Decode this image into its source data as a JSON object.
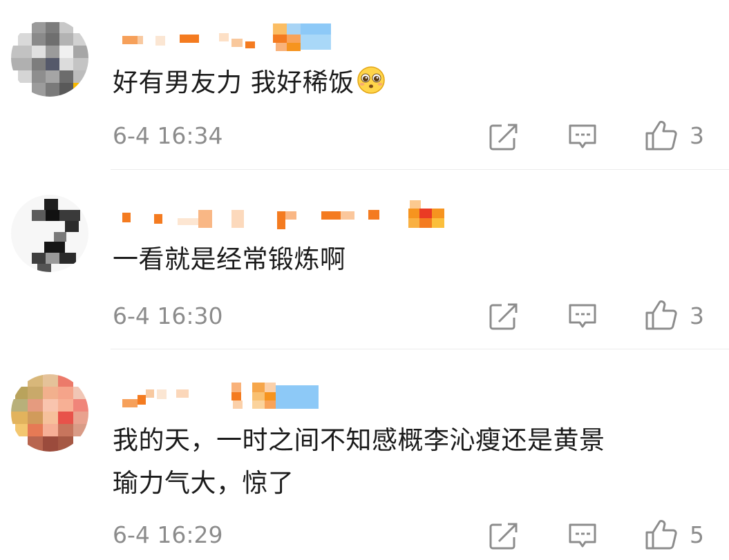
{
  "comments": [
    {
      "text": "好有男友力 我好稀饭",
      "emoji": "pleading-face-emoji",
      "time": "6-4 16:34",
      "likes": "3"
    },
    {
      "text": "一看就是经常锻炼啊",
      "time": "6-4 16:30",
      "likes": "3"
    },
    {
      "text_line1": "我的天，一时之间不知感概李沁瘦还是黄景",
      "text_line2": "瑜力气大，惊了",
      "time": "6-4 16:29",
      "likes": "5"
    }
  ],
  "icons": {
    "share": "share-edit-icon",
    "reply": "comment-bubble-icon",
    "like": "thumbs-up-icon"
  },
  "colors": {
    "text": "#1b1b1b",
    "meta": "#8c8c8c",
    "divider": "#ececec",
    "name_orange": "#f5821f",
    "name_blue": "#7fc4f5"
  }
}
